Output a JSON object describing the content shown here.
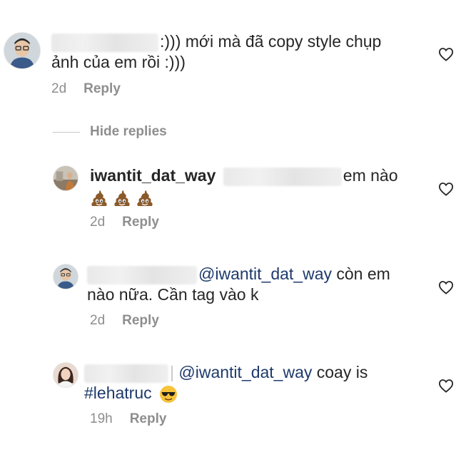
{
  "hide_replies_label": "Hide replies",
  "reply_label": "Reply",
  "comments": [
    {
      "line1": ":))) mới mà đã copy style chụp",
      "line2": "ảnh của em rồi :)))",
      "time": "2d"
    },
    {
      "username": "iwantit_dat_way",
      "text_after": "em nào",
      "emoji": [
        "poo-emoji",
        "poo-emoji",
        "poo-emoji"
      ],
      "time": "2d"
    },
    {
      "mention": "@iwantit_dat_way",
      "text_after": " còn em",
      "line2": "nào nữa. Cần tag vào k",
      "time": "2d"
    },
    {
      "mention": "@iwantit_dat_way",
      "text_after": " coay is",
      "hashtag": "#lehatruc",
      "emoji": [
        "sunglasses-emoji"
      ],
      "time": "19h"
    }
  ],
  "colors": {
    "text": "#262626",
    "secondary": "#8e8e8e",
    "mention": "#1d3a6b"
  }
}
